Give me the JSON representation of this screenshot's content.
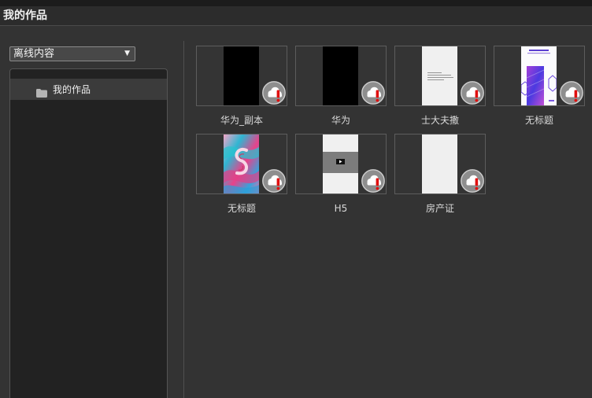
{
  "header": {
    "title": "我的作品"
  },
  "sidebar": {
    "dropdown": {
      "selected": "离线内容",
      "arrow": "▼"
    },
    "tree": [
      {
        "label": "我的作品",
        "icon": "folder-icon",
        "selected": true
      }
    ]
  },
  "works": [
    {
      "title": "华为_副本",
      "sync_icon": "cloud-alert-icon"
    },
    {
      "title": "华为",
      "sync_icon": "cloud-alert-icon"
    },
    {
      "title": "士大夫撒",
      "sync_icon": "cloud-alert-icon"
    },
    {
      "title": "无标题",
      "sync_icon": "cloud-alert-icon"
    },
    {
      "title": "无标题",
      "sync_icon": "cloud-alert-icon"
    },
    {
      "title": "H5",
      "sync_icon": "cloud-alert-icon"
    },
    {
      "title": "房产证",
      "sync_icon": "cloud-alert-icon"
    }
  ],
  "colors": {
    "bg": "#333333",
    "header": "#2c2c2c",
    "tree": "#222222",
    "selected": "#3b3b3b",
    "text": "#d9d9d9",
    "alert": "#e01010"
  }
}
